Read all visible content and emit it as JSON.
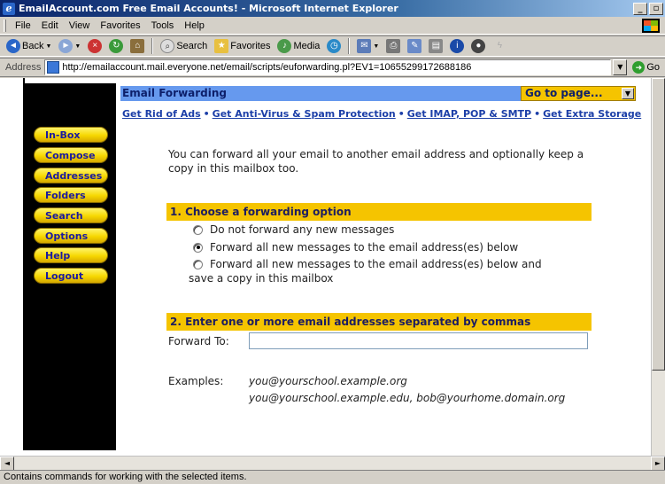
{
  "window": {
    "title": "EmailAccount.com Free Email Accounts! - Microsoft Internet Explorer",
    "minimize_glyph": "_",
    "maximize_glyph": "▫"
  },
  "menu": [
    "File",
    "Edit",
    "View",
    "Favorites",
    "Tools",
    "Help"
  ],
  "toolbar": {
    "back_label": "Back",
    "search_label": "Search",
    "favorites_label": "Favorites",
    "media_label": "Media"
  },
  "address": {
    "label": "Address",
    "url": "http://emailaccount.mail.everyone.net/email/scripts/euforwarding.pl?EV1=10655299172688186",
    "go_label": "Go"
  },
  "nav": [
    "In-Box",
    "Compose",
    "Addresses",
    "Folders",
    "Search",
    "Options",
    "Help",
    "Logout"
  ],
  "header": {
    "title": "Email Forwarding",
    "goto_label": "Go to page..."
  },
  "links": [
    "Get Rid of Ads",
    "Get Anti-Virus & Spam Protection",
    "Get IMAP, POP & SMTP",
    "Get Extra Storage"
  ],
  "intro": "You can forward all your email to another email address and optionally keep a copy in this mailbox too.",
  "section1": {
    "title": "1. Choose a forwarding option",
    "options": [
      {
        "label": "Do not forward any new messages",
        "selected": false
      },
      {
        "label": "Forward all new messages to the email address(es) below",
        "selected": true
      },
      {
        "label": "Forward all new messages to the email address(es) below and",
        "selected": false
      }
    ],
    "option3_cont": "save a copy in this mailbox"
  },
  "section2": {
    "title": "2. Enter one or more email addresses separated by commas",
    "forward_label": "Forward To:",
    "forward_value": ""
  },
  "examples": {
    "label": "Examples:",
    "lines": [
      "you@yourschool.example.org",
      "you@yourschool.example.edu, bob@yourhome.domain.org"
    ]
  },
  "status": "Contains commands for working with the selected items.",
  "colors": {
    "nav_bg": "#000000",
    "nav_button": "#f6d700",
    "header_blue": "#6699ee",
    "section_gold": "#f5c400",
    "link_blue": "#1c3fa8"
  }
}
